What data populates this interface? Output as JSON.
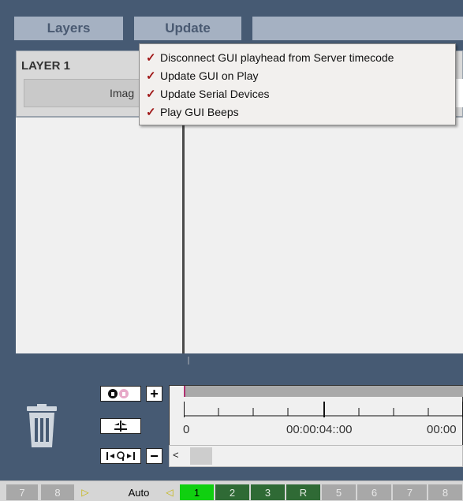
{
  "menu": {
    "layers_label": "Layers",
    "update_label": "Update"
  },
  "layer": {
    "title": "LAYER 1",
    "image_label": "Imag"
  },
  "dropdown": {
    "items": [
      {
        "checked": true,
        "label": "Disconnect GUI playhead from Server timecode"
      },
      {
        "checked": true,
        "label": "Update GUI on Play"
      },
      {
        "checked": true,
        "label": "Update Serial Devices"
      },
      {
        "checked": true,
        "label": "Play GUI Beeps"
      }
    ],
    "check_glyph": "✓"
  },
  "tools": {
    "plus_label": "+",
    "minus_label": "−",
    "lock_icon": "lock-icon",
    "snap_icon": "snap-icon",
    "zoom_icon": "zoom-fit-icon",
    "trash_icon": "trash-icon"
  },
  "timeline": {
    "labels": [
      "0",
      "00:00:04::00",
      "00:00"
    ],
    "scroll_left_glyph": "<"
  },
  "statusbar": {
    "left_items": [
      "7",
      "8"
    ],
    "right_arrow": "▷",
    "mode": "Auto",
    "left_arrow": "◁",
    "selected": "1",
    "green_items": [
      "2",
      "3",
      "R"
    ],
    "grey_items": [
      "5",
      "6",
      "7",
      "8"
    ]
  },
  "colors": {
    "app_background": "#465a73",
    "menu_button": "#a5b1c2",
    "check_mark": "#a01818",
    "active_channel": "#10d010",
    "channel_green": "#2f6a35"
  }
}
